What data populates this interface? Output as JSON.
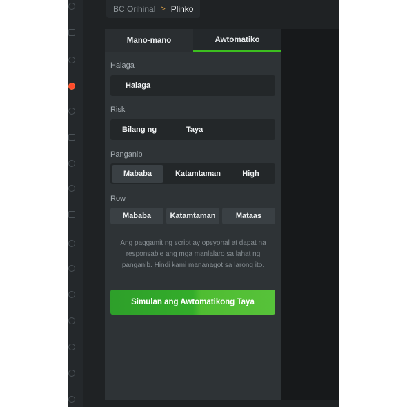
{
  "breadcrumb": {
    "root": "BC Orihinal",
    "separator": ">",
    "current": "Plinko"
  },
  "tabs": [
    {
      "label": "Mano-mano",
      "active": false
    },
    {
      "label": "Awtomatiko",
      "active": true
    }
  ],
  "halaga": {
    "label": "Halaga",
    "value": "Halaga"
  },
  "risk": {
    "label": "Risk",
    "options": [
      "Bilang ng",
      "Taya"
    ]
  },
  "panganib": {
    "label": "Panganib",
    "options": [
      "Mababa",
      "Katamtaman",
      "High"
    ],
    "selected": "Mababa"
  },
  "row": {
    "label": "Row",
    "options": [
      "Mababa",
      "Katamtaman",
      "Mataas"
    ]
  },
  "disclaimer": "Ang paggamit ng script ay opsyonal at dapat na responsable ang mga manlalaro sa lahat ng panganib. Hindi kami mananagot sa larong ito.",
  "start_button": "Simulan ang  Awtomatikong Taya",
  "colors": {
    "accent_green": "#3cbf1f",
    "active_icon": "#ff4b2b",
    "breadcrumb_separator": "#e0a44a"
  },
  "rail_icons": [
    "coin-icon",
    "rocket-icon",
    "dice-icon",
    "plinko-icon",
    "chip-icon",
    "slots-icon",
    "wheel-icon",
    "crash-icon",
    "cards-icon",
    "ball-icon",
    "gift-icon",
    "globe-icon",
    "lottery-icon",
    "bet-icon",
    "trophy-icon",
    "settings-icon"
  ]
}
